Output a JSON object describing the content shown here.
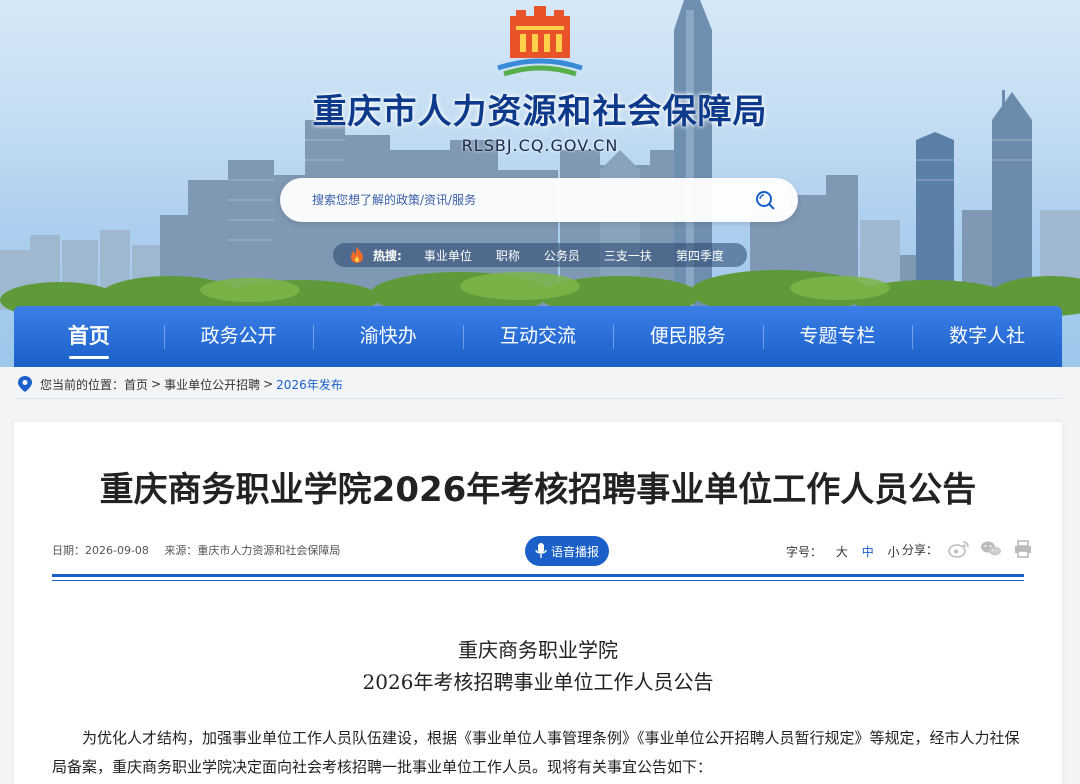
{
  "header": {
    "site_title": "重庆市人力资源和社会保障局",
    "site_domain": "RLSBJ.CQ.GOV.CN",
    "search_placeholder": "搜索您想了解的政策/资讯/服务",
    "hot_label": "热搜:",
    "hot_tags": [
      "事业单位",
      "职称",
      "公务员",
      "三支一扶",
      "第四季度"
    ]
  },
  "nav": {
    "items": [
      "首页",
      "政务公开",
      "渝快办",
      "互动交流",
      "便民服务",
      "专题专栏",
      "数字人社"
    ],
    "active_index": 0
  },
  "breadcrumb": {
    "prefix": "您当前的位置：",
    "items": [
      "首页",
      "事业单位公开招聘",
      "2026年发布"
    ],
    "separator": ">"
  },
  "article": {
    "title": "重庆商务职业学院2026年考核招聘事业单位工作人员公告",
    "date": "日期：2026-09-08",
    "source": "来源：重庆市人力资源和社会保障局",
    "voice_label": "语音播报",
    "font_size_label": "字号：",
    "font_sizes": [
      "大",
      "中",
      "小"
    ],
    "font_size_selected": "中",
    "share_label": "分享：",
    "share_icons": [
      "weibo-icon",
      "wechat-icon",
      "print-icon"
    ],
    "subtitle_line1": "重庆商务职业学院",
    "subtitle_line2": "2026年考核招聘事业单位工作人员公告",
    "paragraph": "为优化人才结构，加强事业单位工作人员队伍建设，根据《事业单位人事管理条例》《事业单位公开招聘人员暂行规定》等规定，经市人力社保局备案，重庆商务职业学院决定面向社会考核招聘一批事业单位工作人员。现将有关事宜公告如下："
  },
  "colors": {
    "primary": "#1b5fc9",
    "title_blue": "#0e3a8c"
  }
}
